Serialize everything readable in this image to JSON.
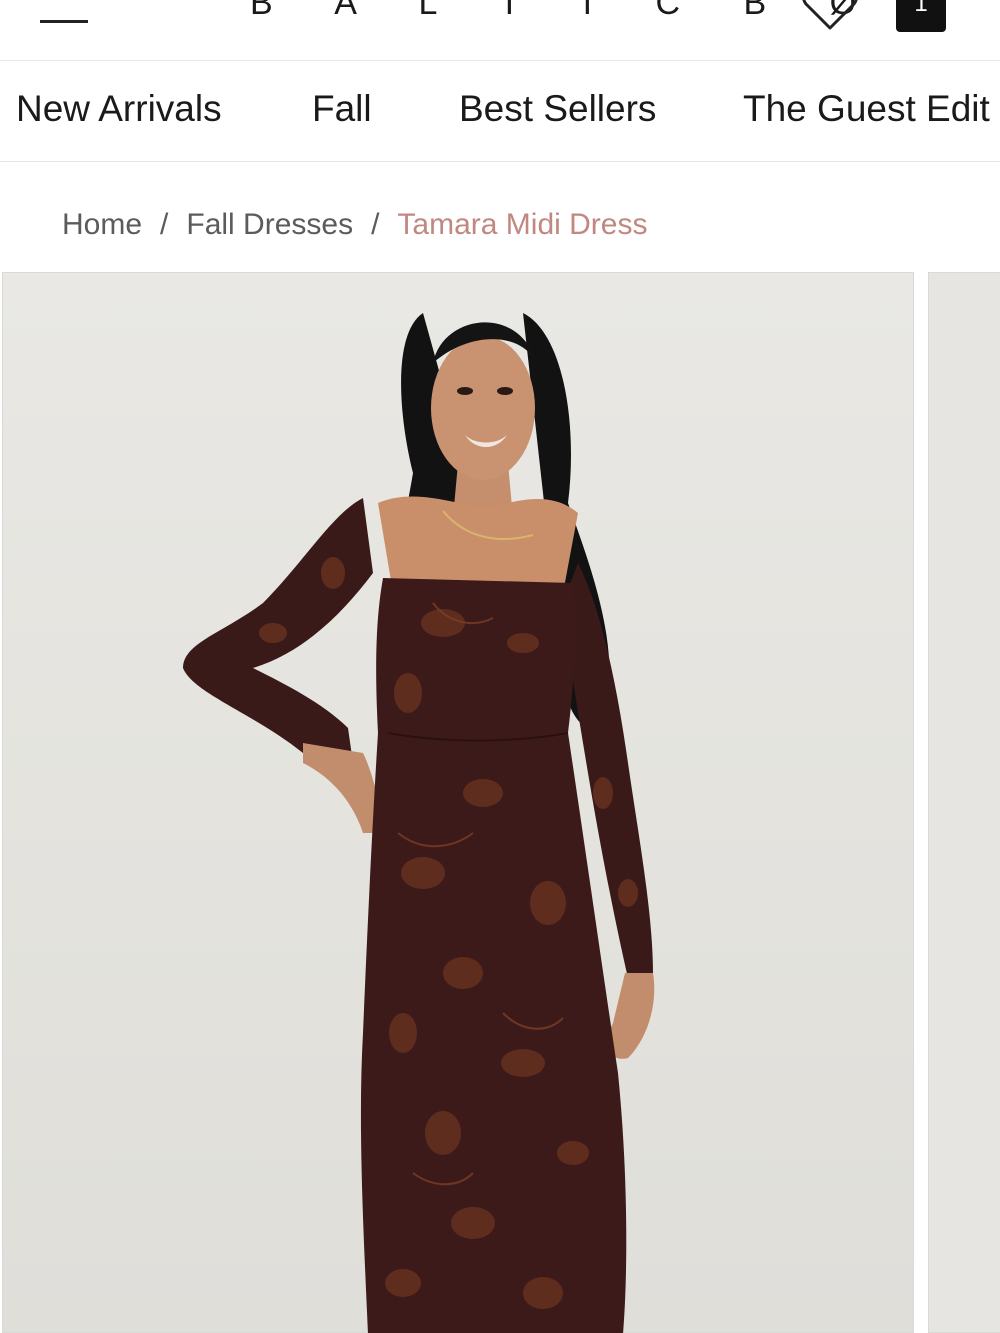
{
  "header": {
    "brand": "B A L T I C B Ø R N",
    "cart_count": "1"
  },
  "nav": {
    "items": [
      {
        "label": "New Arrivals"
      },
      {
        "label": "Fall"
      },
      {
        "label": "Best Sellers"
      },
      {
        "label": "The Guest Edit"
      }
    ]
  },
  "breadcrumb": {
    "home": "Home",
    "category": "Fall Dresses",
    "separator": "/",
    "current": "Tamara Midi Dress"
  },
  "colors": {
    "accent": "#c08880",
    "dress": "#3d1a1a",
    "background": "#e6e5e1"
  },
  "icons": {
    "menu": "hamburger-menu-icon",
    "wishlist": "heart-icon",
    "cart": "shopping-bag-icon"
  }
}
